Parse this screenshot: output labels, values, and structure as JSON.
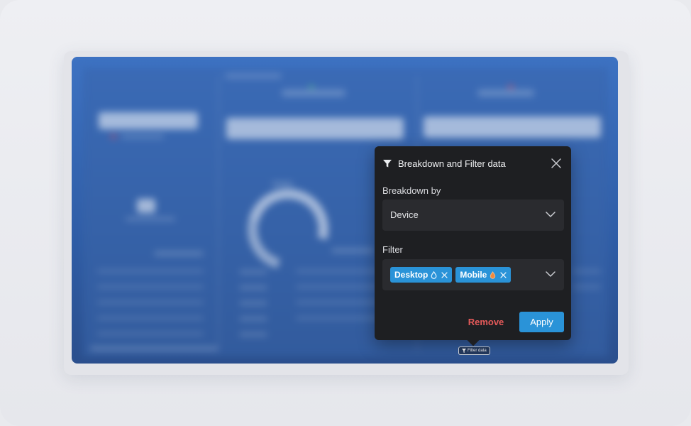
{
  "popup": {
    "title": "Breakdown and Filter data",
    "breakdown_label": "Breakdown by",
    "breakdown_value": "Device",
    "filter_label": "Filter",
    "filters": [
      {
        "label": "Desktop",
        "drop_color": "#8fd0ff"
      },
      {
        "label": "Mobile",
        "drop_color": "#f28a3c"
      }
    ],
    "remove_label": "Remove",
    "apply_label": "Apply"
  },
  "filter_tag": {
    "label": "Filter data"
  },
  "colors": {
    "accent": "#2a93d8",
    "danger": "#e55a5a",
    "popup_bg": "#1e1f22",
    "field_bg": "#2a2b2f"
  }
}
